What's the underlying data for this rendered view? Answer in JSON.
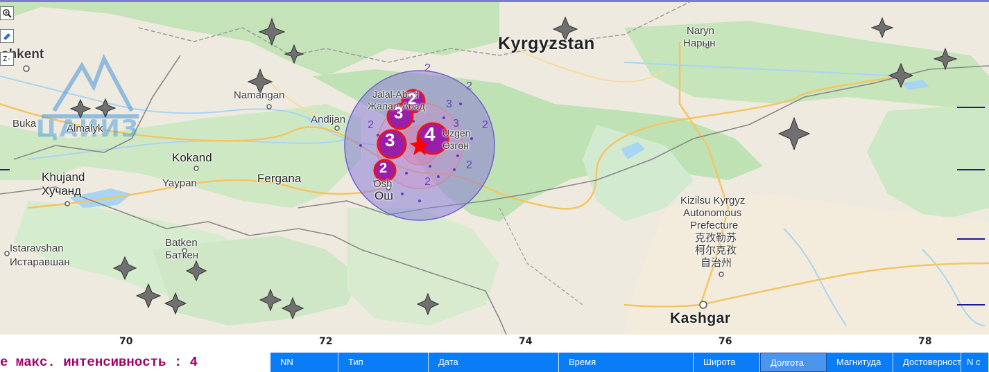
{
  "map": {
    "country_labels": {
      "kyrgyzstan": "Kyrgyzstan"
    },
    "city_labels": {
      "tashkent": "shkent",
      "naryn_lat": "Naryn",
      "naryn_cyr": "Нарын",
      "namangan": "Namangan",
      "andijan": "Andijan",
      "jalalabad_lat": "Jalal-Abad",
      "jalalabad_cyr": "Жалал-Абад",
      "uzgen_lat": "Uzgen",
      "uzgen_cyr": "Өзгөн",
      "osh_lat": "Osh",
      "osh_cyr": "Ош",
      "buka": "Buka",
      "almalyk": "Almalyk",
      "kokand": "Kokand",
      "khujand_lat": "Khujand",
      "khujand_cyr": "Хучанд",
      "yaypan": "Yaypan",
      "fergana": "Fergana",
      "istaravshan_lat": "Istaravshan",
      "istaravshan_cyr": "Истаравшан",
      "batken_lat": "Batken",
      "batken_cyr": "Баткен",
      "kizilsu_1": "Kizilsu Kyrgyz",
      "kizilsu_2": "Autonomous",
      "kizilsu_3": "Prefecture",
      "kizilsu_4": "克孜勒苏",
      "kizilsu_5": "柯尔克孜",
      "kizilsu_6": "自治州",
      "kashgar": "Kashgar"
    },
    "logo_text": "ЦАИИЗ",
    "intensity_labels": {
      "i2": "2",
      "i3": "3",
      "i4": "4"
    },
    "event_markers": [
      "2",
      "3",
      "3",
      "4",
      "2"
    ],
    "colors": {
      "water": "#9fd3f5",
      "land": "#f1ede3",
      "forest": "#bfe2b4",
      "felt_area": "#8b7cd9",
      "marker_fill": "#9a1fa8",
      "marker_ring": "#e8141c",
      "epicenter": "#ff0000",
      "station": "#6e6e6e"
    }
  },
  "axis": {
    "longitude_ticks": [
      "70",
      "72",
      "74",
      "76",
      "78"
    ]
  },
  "status": {
    "text": "е макс. интенсивность : 4"
  },
  "table": {
    "columns": [
      "NN",
      "Тип",
      "Дата",
      "Время",
      "Широта",
      "Долгота",
      "Магнитуда",
      "Достоверность",
      "N с"
    ],
    "active_column": "Долгота"
  },
  "tools": {
    "zoom_label": "zoom",
    "erase_label": "erase",
    "z_label": "Z-"
  }
}
